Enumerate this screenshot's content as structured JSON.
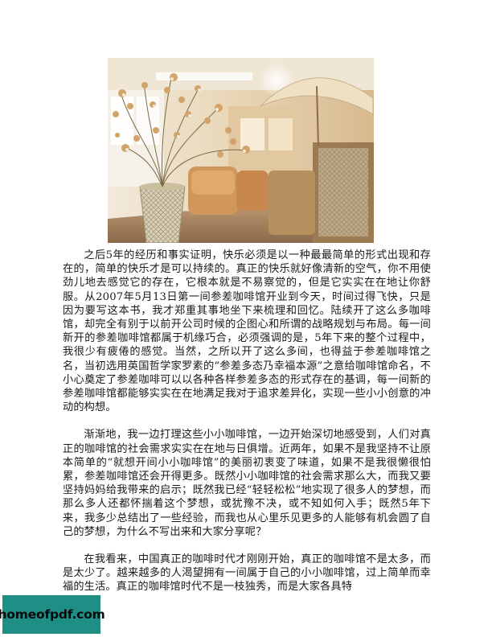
{
  "photo": {
    "alt": "cafe interior with dried flowers in a wicker vase"
  },
  "paragraphs": [
    "之后5年的经历和事实证明，快乐必须是以一种最最简单的形式出现和存在的，简单的快乐才是可以持续的。真正的快乐就好像清新的空气，你不用使劲儿地去感觉它的存在，它根本就是不易察觉的，但是它实实在在地让你舒服。从2007年5月13日第一间参差咖啡馆开业到今天，时间过得飞快，只是因为要写这本书，我才郑重其事地坐下来梳理和回忆。陆续开了这么多咖啡馆，却完全有别于以前开公司时候的企图心和所谓的战略规划与布局。每一间新开的参差咖啡馆都属于机缘巧合，必须强调的是，5年下来的整个过程中，我很少有疲倦的感觉。当然，之所以开了这么多间，也得益于参差咖啡馆之名，当初选用英国哲学家罗素的“参差多态乃幸福本源”之意给咖啡馆命名，不小心奠定了参差咖啡可以以各种各样参差多态的形式存在的基调，每一间新的参差咖啡馆都能够实实在在地满足我对于追求差异化，实现一些小小创意的冲动的构想。",
    "渐渐地，我一边打理这些小小咖啡馆，一边开始深切地感受到，人们对真正的咖啡馆的社会需求实实在在地与日俱增。近两年，如果不是我坚持不让原本简单的“就想开间小小咖啡馆”的美丽初衷变了味道，如果不是我很懒很怕累，参差咖啡馆还会开得更多。既然小小咖啡馆的社会需求那么大，而我又要坚持妈妈给我带来的启示；既然我已经“轻轻松松”地实现了很多人的梦想，而那么多人还都怀揣着这个梦想，或犹豫不决，或不知如何入手；既然5年下来，我多少总结出了一些经验，而我也从心里乐见更多的人能够有机会圆了自己的梦想，为什么不写出来和大家分享呢？",
    "在我看来，中国真正的咖啡时代才刚刚开始，真正的咖啡馆不是太多，而是太少了。越来越多的人渴望拥有一间属于自己的小小咖啡馆，过上简单而幸福的生活。真正的咖啡馆时代不是一枝独秀，而是大家各具特"
  ],
  "watermark": {
    "text": "homeofpdf.com"
  },
  "colors": {
    "badge": "#1f8f86",
    "text": "#1a1a1a"
  }
}
